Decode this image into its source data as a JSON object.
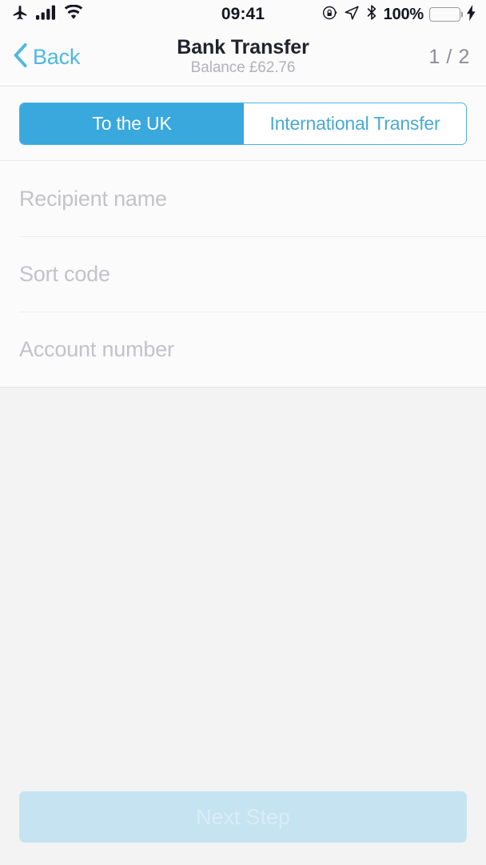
{
  "status_bar": {
    "time": "09:41",
    "battery_percent": "100%",
    "icons_left": [
      "airplane-mode-icon",
      "cellular-signal-icon",
      "wifi-icon"
    ],
    "icons_right": [
      "rotation-lock-icon",
      "location-arrow-icon",
      "bluetooth-icon",
      "battery-icon",
      "charging-bolt-icon"
    ],
    "battery_color": "#4cd964"
  },
  "nav": {
    "back_label": "Back",
    "title": "Bank Transfer",
    "subtitle": "Balance £62.76",
    "step_indicator": "1 / 2",
    "accent_color": "#4cb8e2"
  },
  "segmented_control": {
    "selected_index": 0,
    "options": [
      {
        "label": "To the UK"
      },
      {
        "label": "International Transfer"
      }
    ],
    "active_bg": "#38a8dd",
    "active_text": "#ffffff",
    "inactive_text": "#49a9d6",
    "border_color": "#49b2dd"
  },
  "form": {
    "fields": [
      {
        "name": "recipient-name",
        "placeholder": "Recipient name",
        "value": ""
      },
      {
        "name": "sort-code",
        "placeholder": "Sort code",
        "value": ""
      },
      {
        "name": "account-number",
        "placeholder": "Account number",
        "value": ""
      }
    ]
  },
  "footer": {
    "next_label": "Next Step",
    "enabled": false,
    "disabled_bg": "#c6e3f1",
    "disabled_text": "#d9edf7"
  }
}
